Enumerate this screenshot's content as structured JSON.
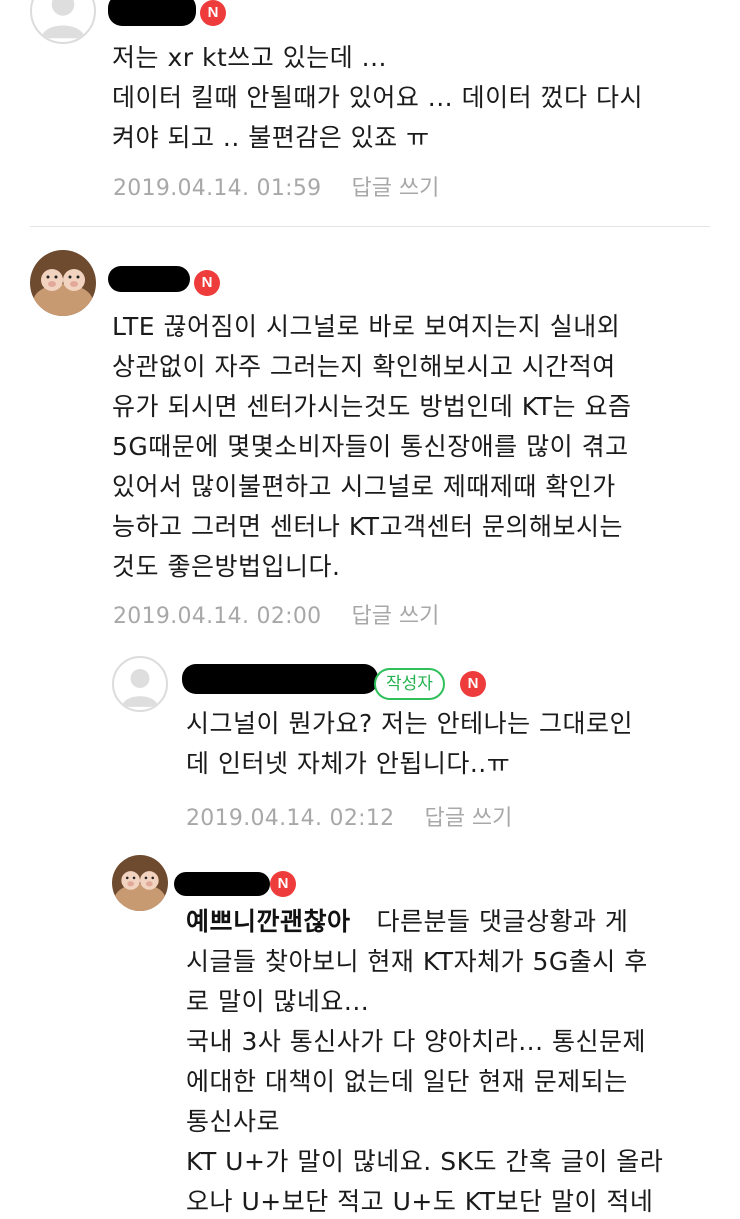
{
  "comments": [
    {
      "lines": [
        "저는 xr kt쓰고 있는데 ...",
        "데이터 킬때 안될때가 있어요 ... 데이터 껐다 다시",
        "켜야 되고 .. 불편감은 있죠 ㅠ"
      ],
      "date": "2019.04.14. 01:59",
      "reply_label": "답글 쓰기",
      "new_badge": "N"
    },
    {
      "lines": [
        "LTE 끊어짐이 시그널로 바로 보여지는지 실내외",
        "상관없이 자주 그러는지 확인해보시고 시간적여",
        "유가 되시면 센터가시는것도 방법인데 KT는 요즘",
        "5G때문에 몇몇소비자들이 통신장애를 많이 겪고",
        "있어서 많이불편하고 시그널로 제때제때 확인가",
        "능하고 그러면 센터나 KT고객센터 문의해보시는",
        "것도 좋은방법입니다."
      ],
      "date": "2019.04.14. 02:00",
      "reply_label": "답글 쓰기",
      "new_badge": "N"
    },
    {
      "author_badge": "작성자",
      "lines": [
        "시그널이 뭔가요? 저는 안테나는 그대로인",
        "데 인터넷 자체가 안됩니다..ㅠ"
      ],
      "date": "2019.04.14. 02:12",
      "reply_label": "답글 쓰기",
      "new_badge": "N"
    },
    {
      "mention": "예쁘니깐괜찮아",
      "first_line": "다른분들 댓글상황과 게",
      "lines": [
        "시글들 찾아보니 현재 KT자체가 5G출시 후",
        "로 말이 많네요...",
        "국내 3사 통신사가 다 양아치라... 통신문제",
        "에대한 대책이 없는데 일단 현재 문제되는",
        "통신사로",
        "KT U+가 말이 많네요. SK도 간혹 글이 올라",
        "오나 U+보단 적고 U+도 KT보단 말이 적네"
      ],
      "new_badge": "N"
    }
  ]
}
